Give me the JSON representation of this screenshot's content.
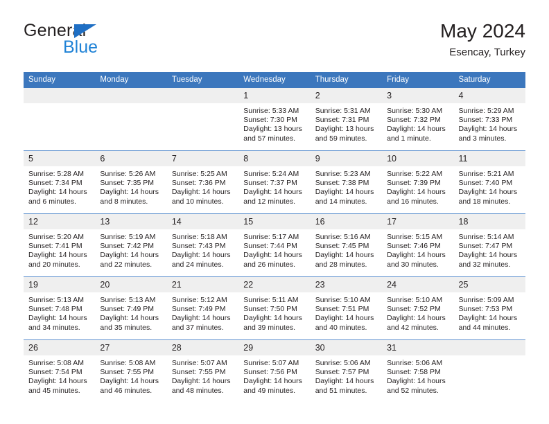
{
  "brand": {
    "name_top": "General",
    "name_bottom": "Blue",
    "logo_icon": "blue-triangle-icon",
    "colors": {
      "accent": "#1f82d6",
      "triangle": "#1f6fc4",
      "text": "#231f20"
    }
  },
  "header": {
    "title": "May 2024",
    "subtitle": "Esencay, Turkey"
  },
  "theme": {
    "header_row_bg": "#3c77bd",
    "header_row_text": "#ffffff",
    "daynum_bg": "#efefef",
    "row_divider": "#5b8fce",
    "cell_bg": "#ffffff"
  },
  "calendar": {
    "weekday_headers": [
      "Sunday",
      "Monday",
      "Tuesday",
      "Wednesday",
      "Thursday",
      "Friday",
      "Saturday"
    ],
    "weeks": [
      [
        {
          "day": "",
          "lines": []
        },
        {
          "day": "",
          "lines": []
        },
        {
          "day": "",
          "lines": []
        },
        {
          "day": "1",
          "lines": [
            "Sunrise: 5:33 AM",
            "Sunset: 7:30 PM",
            "Daylight: 13 hours and 57 minutes."
          ]
        },
        {
          "day": "2",
          "lines": [
            "Sunrise: 5:31 AM",
            "Sunset: 7:31 PM",
            "Daylight: 13 hours and 59 minutes."
          ]
        },
        {
          "day": "3",
          "lines": [
            "Sunrise: 5:30 AM",
            "Sunset: 7:32 PM",
            "Daylight: 14 hours and 1 minute."
          ]
        },
        {
          "day": "4",
          "lines": [
            "Sunrise: 5:29 AM",
            "Sunset: 7:33 PM",
            "Daylight: 14 hours and 3 minutes."
          ]
        }
      ],
      [
        {
          "day": "5",
          "lines": [
            "Sunrise: 5:28 AM",
            "Sunset: 7:34 PM",
            "Daylight: 14 hours and 6 minutes."
          ]
        },
        {
          "day": "6",
          "lines": [
            "Sunrise: 5:26 AM",
            "Sunset: 7:35 PM",
            "Daylight: 14 hours and 8 minutes."
          ]
        },
        {
          "day": "7",
          "lines": [
            "Sunrise: 5:25 AM",
            "Sunset: 7:36 PM",
            "Daylight: 14 hours and 10 minutes."
          ]
        },
        {
          "day": "8",
          "lines": [
            "Sunrise: 5:24 AM",
            "Sunset: 7:37 PM",
            "Daylight: 14 hours and 12 minutes."
          ]
        },
        {
          "day": "9",
          "lines": [
            "Sunrise: 5:23 AM",
            "Sunset: 7:38 PM",
            "Daylight: 14 hours and 14 minutes."
          ]
        },
        {
          "day": "10",
          "lines": [
            "Sunrise: 5:22 AM",
            "Sunset: 7:39 PM",
            "Daylight: 14 hours and 16 minutes."
          ]
        },
        {
          "day": "11",
          "lines": [
            "Sunrise: 5:21 AM",
            "Sunset: 7:40 PM",
            "Daylight: 14 hours and 18 minutes."
          ]
        }
      ],
      [
        {
          "day": "12",
          "lines": [
            "Sunrise: 5:20 AM",
            "Sunset: 7:41 PM",
            "Daylight: 14 hours and 20 minutes."
          ]
        },
        {
          "day": "13",
          "lines": [
            "Sunrise: 5:19 AM",
            "Sunset: 7:42 PM",
            "Daylight: 14 hours and 22 minutes."
          ]
        },
        {
          "day": "14",
          "lines": [
            "Sunrise: 5:18 AM",
            "Sunset: 7:43 PM",
            "Daylight: 14 hours and 24 minutes."
          ]
        },
        {
          "day": "15",
          "lines": [
            "Sunrise: 5:17 AM",
            "Sunset: 7:44 PM",
            "Daylight: 14 hours and 26 minutes."
          ]
        },
        {
          "day": "16",
          "lines": [
            "Sunrise: 5:16 AM",
            "Sunset: 7:45 PM",
            "Daylight: 14 hours and 28 minutes."
          ]
        },
        {
          "day": "17",
          "lines": [
            "Sunrise: 5:15 AM",
            "Sunset: 7:46 PM",
            "Daylight: 14 hours and 30 minutes."
          ]
        },
        {
          "day": "18",
          "lines": [
            "Sunrise: 5:14 AM",
            "Sunset: 7:47 PM",
            "Daylight: 14 hours and 32 minutes."
          ]
        }
      ],
      [
        {
          "day": "19",
          "lines": [
            "Sunrise: 5:13 AM",
            "Sunset: 7:48 PM",
            "Daylight: 14 hours and 34 minutes."
          ]
        },
        {
          "day": "20",
          "lines": [
            "Sunrise: 5:13 AM",
            "Sunset: 7:49 PM",
            "Daylight: 14 hours and 35 minutes."
          ]
        },
        {
          "day": "21",
          "lines": [
            "Sunrise: 5:12 AM",
            "Sunset: 7:49 PM",
            "Daylight: 14 hours and 37 minutes."
          ]
        },
        {
          "day": "22",
          "lines": [
            "Sunrise: 5:11 AM",
            "Sunset: 7:50 PM",
            "Daylight: 14 hours and 39 minutes."
          ]
        },
        {
          "day": "23",
          "lines": [
            "Sunrise: 5:10 AM",
            "Sunset: 7:51 PM",
            "Daylight: 14 hours and 40 minutes."
          ]
        },
        {
          "day": "24",
          "lines": [
            "Sunrise: 5:10 AM",
            "Sunset: 7:52 PM",
            "Daylight: 14 hours and 42 minutes."
          ]
        },
        {
          "day": "25",
          "lines": [
            "Sunrise: 5:09 AM",
            "Sunset: 7:53 PM",
            "Daylight: 14 hours and 44 minutes."
          ]
        }
      ],
      [
        {
          "day": "26",
          "lines": [
            "Sunrise: 5:08 AM",
            "Sunset: 7:54 PM",
            "Daylight: 14 hours and 45 minutes."
          ]
        },
        {
          "day": "27",
          "lines": [
            "Sunrise: 5:08 AM",
            "Sunset: 7:55 PM",
            "Daylight: 14 hours and 46 minutes."
          ]
        },
        {
          "day": "28",
          "lines": [
            "Sunrise: 5:07 AM",
            "Sunset: 7:55 PM",
            "Daylight: 14 hours and 48 minutes."
          ]
        },
        {
          "day": "29",
          "lines": [
            "Sunrise: 5:07 AM",
            "Sunset: 7:56 PM",
            "Daylight: 14 hours and 49 minutes."
          ]
        },
        {
          "day": "30",
          "lines": [
            "Sunrise: 5:06 AM",
            "Sunset: 7:57 PM",
            "Daylight: 14 hours and 51 minutes."
          ]
        },
        {
          "day": "31",
          "lines": [
            "Sunrise: 5:06 AM",
            "Sunset: 7:58 PM",
            "Daylight: 14 hours and 52 minutes."
          ]
        },
        {
          "day": "",
          "lines": []
        }
      ]
    ]
  }
}
